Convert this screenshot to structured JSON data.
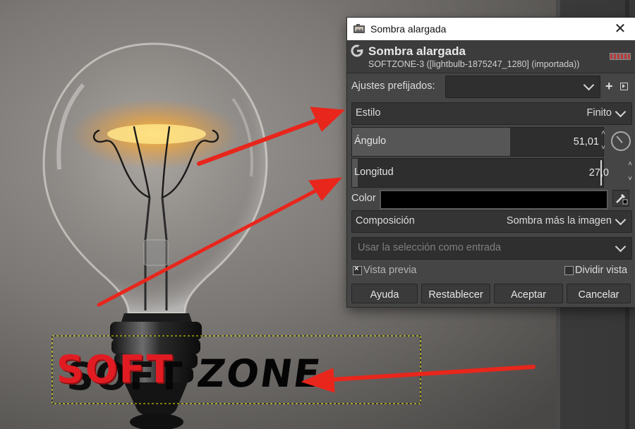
{
  "window": {
    "title": "Sombra alargada"
  },
  "header": {
    "title": "Sombra alargada",
    "subtitle": "SOFTZONE-3 ([lightbulb-1875247_1280] (importada))"
  },
  "presets": {
    "label": "Ajustes prefijados:",
    "value": ""
  },
  "style": {
    "label": "Estilo",
    "value": "Finito"
  },
  "angle": {
    "label": "Ángulo",
    "value": "51,01"
  },
  "length": {
    "label": "Longitud",
    "value": "27,0"
  },
  "color": {
    "label": "Color",
    "value": "#000000"
  },
  "composition": {
    "label": "Composición",
    "value": "Sombra más la imagen"
  },
  "use_selection": {
    "placeholder": "Usar la selección como entrada"
  },
  "preview": {
    "label": "Vista previa",
    "checked": true
  },
  "split": {
    "label": "Dividir vista",
    "checked": false
  },
  "buttons": {
    "help": "Ayuda",
    "reset": "Restablecer",
    "ok": "Aceptar",
    "cancel": "Cancelar"
  },
  "canvas": {
    "text": "SOFT",
    "shadow_text": "ZONE"
  },
  "colors": {
    "annotation_arrow": "#e8261c",
    "text_red": "#e01c22",
    "dialog_bg": "#454545"
  }
}
